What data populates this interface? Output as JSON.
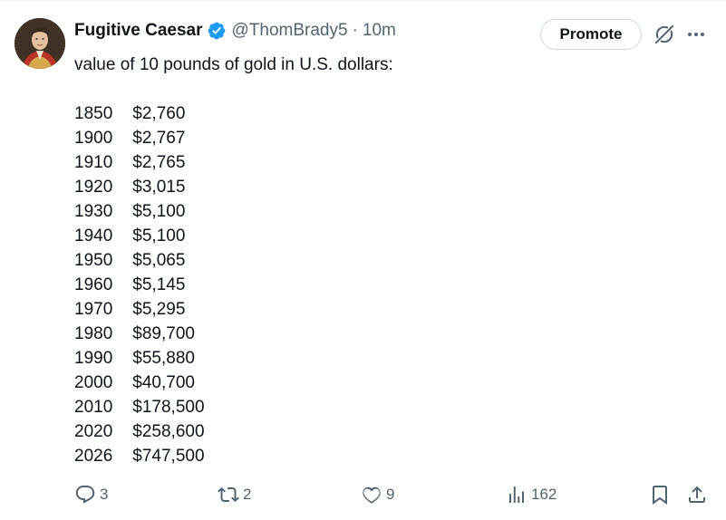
{
  "author": {
    "name": "Fugitive Caesar",
    "handle": "@ThomBrady5",
    "separator": "·",
    "time": "10m"
  },
  "header": {
    "promote_label": "Promote"
  },
  "tweet": {
    "intro": "value of 10 pounds of gold in U.S. dollars:",
    "rows": [
      {
        "year": "1850",
        "value": "$2,760"
      },
      {
        "year": "1900",
        "value": "$2,767"
      },
      {
        "year": "1910",
        "value": "$2,765"
      },
      {
        "year": "1920",
        "value": "$3,015"
      },
      {
        "year": "1930",
        "value": "$5,100"
      },
      {
        "year": "1940",
        "value": "$5,100"
      },
      {
        "year": "1950",
        "value": "$5,065"
      },
      {
        "year": "1960",
        "value": "$5,145"
      },
      {
        "year": "1970",
        "value": "$5,295"
      },
      {
        "year": "1980",
        "value": "$89,700"
      },
      {
        "year": "1990",
        "value": "$55,880"
      },
      {
        "year": "2000",
        "value": "$40,700"
      },
      {
        "year": "2010",
        "value": "$178,500"
      },
      {
        "year": "2020",
        "value": "$258,600"
      },
      {
        "year": "2026",
        "value": "$747,500"
      }
    ]
  },
  "actions": {
    "replies": "3",
    "reposts": "2",
    "likes": "9",
    "views": "162"
  },
  "colors": {
    "text": "#0f1419",
    "secondary": "#536471",
    "verified": "#1d9bf0",
    "border": "#cfd9de"
  },
  "icons": [
    "verified-badge-icon",
    "grok-icon",
    "more-icon",
    "reply-icon",
    "repost-icon",
    "like-icon",
    "views-icon",
    "bookmark-icon",
    "share-icon"
  ]
}
